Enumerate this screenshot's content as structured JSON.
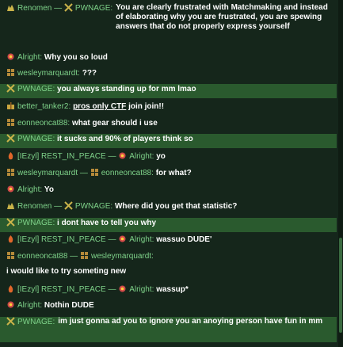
{
  "icon_names": {
    "wolf": "wolf-icon",
    "crossed_sword": "crossed-sword-icon",
    "grid": "grid-icon",
    "star": "star-icon",
    "flame": "flame-icon",
    "gift": "gift-icon"
  },
  "colors": {
    "background": "#15261b",
    "highlight": "#2a5a2e",
    "username": "#7fd38a",
    "message": "#ffffff"
  },
  "messages": [
    {
      "users": [
        "Renomen",
        "PWNAGE"
      ],
      "text": "You are clearly frustrated with Matchmaking and instead of elaborating why you are frustrated, you are spewing answers that do not properly express yourself",
      "hl": false
    },
    {
      "users": [
        "Alright"
      ],
      "text": "Why you so loud",
      "hl": false
    },
    {
      "users": [
        "wesleymarquardt"
      ],
      "text": "???",
      "hl": false
    },
    {
      "users": [
        "PWNAGE"
      ],
      "text": "you always standing up for mm lmao",
      "hl": true
    },
    {
      "users": [
        "better_tanker2"
      ],
      "text_underlined": "pros only CTF",
      "text_after": " join join!!",
      "hl": false
    },
    {
      "users": [
        "eonneoncat88"
      ],
      "text": "what gear should i use",
      "hl": false
    },
    {
      "users": [
        "PWNAGE"
      ],
      "text": "it sucks and 90% of players think so",
      "hl": true
    },
    {
      "users": [
        "[IEzyl] REST_IN_PEACE",
        "Alright"
      ],
      "text": "yo",
      "hl": false
    },
    {
      "users": [
        "wesleymarquardt",
        "eonneoncat88"
      ],
      "text": "for what?",
      "hl": false
    },
    {
      "users": [
        "Alright"
      ],
      "text": "Yo",
      "hl": false
    },
    {
      "users": [
        "Renomen",
        "PWNAGE"
      ],
      "text": "Where did you get that statistic?",
      "hl": false
    },
    {
      "users": [
        "PWNAGE"
      ],
      "text": "i dont have to tell you why",
      "hl": true
    },
    {
      "users": [
        "[IEzyl] REST_IN_PEACE",
        "Alright"
      ],
      "text": "wassuo DUDE'",
      "hl": false
    },
    {
      "users": [
        "eonneoncat88",
        "wesleymarquardt"
      ],
      "text": "",
      "hl": false
    },
    {
      "plain": "i would like to try someting new"
    },
    {
      "users": [
        "[IEzyl] REST_IN_PEACE",
        "Alright"
      ],
      "text": "wassup*",
      "hl": false
    },
    {
      "users": [
        "Alright"
      ],
      "text": "Nothin DUDE",
      "hl": false
    },
    {
      "users": [
        "PWNAGE"
      ],
      "text": "im just gonna ad you to ignore you an anoying person have fun in mm",
      "hl": true
    }
  ]
}
